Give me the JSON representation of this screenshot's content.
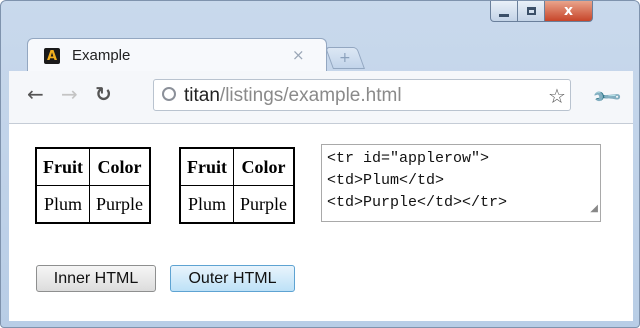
{
  "tab": {
    "title": "Example",
    "close_glyph": "×",
    "favicon_letter": "A",
    "newtab_glyph": "+"
  },
  "window_controls": {
    "close_glyph": "x"
  },
  "toolbar": {
    "url_host": "titan",
    "url_path": "/listings/example.html",
    "icons": [
      "back-arrow-icon",
      "forward-arrow-icon",
      "reload-icon",
      "globe-icon",
      "star-icon",
      "wrench-icon"
    ]
  },
  "tables": [
    {
      "headers": [
        "Fruit",
        "Color"
      ],
      "row": [
        "Plum",
        "Purple"
      ]
    },
    {
      "headers": [
        "Fruit",
        "Color"
      ],
      "row": [
        "Plum",
        "Purple"
      ]
    }
  ],
  "code_text": {
    "line1": "<tr id=\"applerow\">",
    "line2": "<td>Plum</td>",
    "line3": "<td>Purple</td></tr>"
  },
  "buttons": {
    "inner": "Inner HTML",
    "outer": "Outer HTML"
  },
  "colors": {
    "window_frame": "#b8cde6",
    "close_button": "#c7452a",
    "outer_button_bg": "#bde1f7"
  }
}
